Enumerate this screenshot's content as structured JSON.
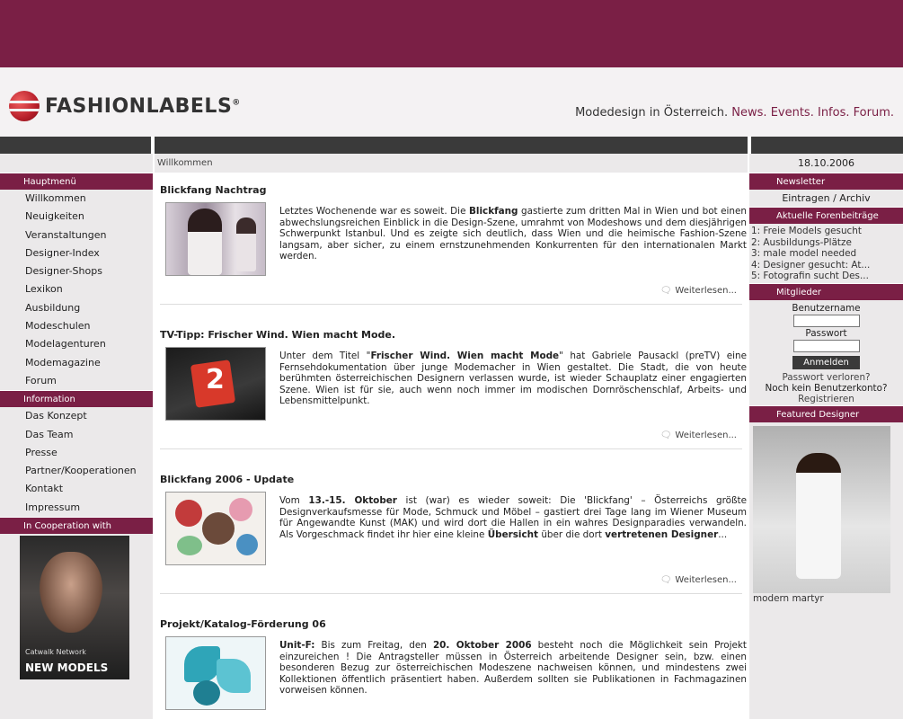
{
  "header": {
    "logo_text": "FASHIONLABELS",
    "logo_mark": "®",
    "tagline_prefix": "Modedesign in Österreich.",
    "tagline_links": [
      "News.",
      "Events.",
      "Infos.",
      "Forum."
    ]
  },
  "breadcrumb": "Willkommen",
  "date": "18.10.2006",
  "left_nav": {
    "main_head": "Hauptmenü",
    "main_items": [
      "Willkommen",
      "Neuigkeiten",
      "Veranstaltungen",
      "Designer-Index",
      "Designer-Shops",
      "Lexikon",
      "Ausbildung",
      "Modeschulen",
      "Modelagenturen",
      "Modemagazine",
      "Forum"
    ],
    "info_head": "Information",
    "info_items": [
      "Das Konzept",
      "Das Team",
      "Presse",
      "Partner/Kooperationen",
      "Kontakt",
      "Impressum"
    ],
    "coop_head": "In Cooperation with",
    "coop_small": "Catwalk Network",
    "coop_big": "NEW MODELS"
  },
  "articles": [
    {
      "title": "Blickfang Nachtrag",
      "text_html": "Letztes Wochenende war es soweit. Die <b>Blickfang</b> gastierte zum dritten Mal in Wien und bot einen abwechslungsreichen Einblick in die Design-Szene, umrahmt von Modeshows und dem diesjährigen Schwerpunkt Istanbul. Und es zeigte sich deutlich, dass Wien und die heimische Fashion-Szene langsam, aber sicher, zu einem ernstzunehmenden Konkurrenten für den internationalen Markt werden.",
      "more": "Weiterlesen..."
    },
    {
      "title": "TV-Tipp: Frischer Wind. Wien macht Mode.",
      "text_html": "Unter dem Titel \"<b>Frischer Wind. Wien macht Mode</b>\" hat Gabriele Pausackl (preTV) eine Fernsehdokumentation über junge Modemacher in Wien gestaltet. Die Stadt, die von heute berühmten österreichischen Designern verlassen wurde, ist wieder Schauplatz einer engagierten Szene. Wien ist für sie, auch wenn noch immer im modischen Dornröschenschlaf, Arbeits- und Lebensmittelpunkt.",
      "more": "Weiterlesen...",
      "thumb_label": "2"
    },
    {
      "title": "Blickfang 2006 - Update",
      "text_html": "Vom <b>13.-15. Oktober</b> ist (war) es wieder soweit: Die 'Blickfang' – Österreichs größte Designverkaufsmesse für Mode, Schmuck und Möbel – gastiert drei Tage lang im Wiener Museum für Angewandte Kunst (MAK) und wird dort die Hallen in ein wahres Designparadies verwandeln. Als Vorgeschmack findet ihr hier eine kleine <b>Übersicht</b> über die dort <b>vertretenen Designer</b>...",
      "more": "Weiterlesen..."
    },
    {
      "title": "Projekt/Katalog-Förderung 06",
      "text_html": "<b>Unit-F:</b> Bis zum Freitag, den <b>20. Oktober 2006</b> besteht noch die Möglichkeit sein Projekt einzureichen ! Die Antragsteller müssen in Österreich arbeitende Designer sein, bzw. einen besonderen Bezug zur österreichischen Modeszene nachweisen können, und mindestens zwei Kollektionen öffentlich präsentiert haben. Außerdem sollten sie Publikationen in Fachmagazinen vorweisen können."
    }
  ],
  "right": {
    "newsletter_head": "Newsletter",
    "newsletter_link": "Eintragen / Archiv",
    "forum_head": "Aktuelle Forenbeiträge",
    "forum_items": [
      "1: Freie Models gesucht",
      "2: Ausbildungs-Plätze",
      "3: male model needed",
      "4: Designer gesucht: At...",
      "5: Fotografin sucht Des..."
    ],
    "members_head": "Mitglieder",
    "username_label": "Benutzername",
    "password_label": "Passwort",
    "login_button": "Anmelden",
    "forgot": "Passwort verloren?",
    "no_account": "Noch kein Benutzerkonto?",
    "register": "Registrieren",
    "featured_head": "Featured Designer",
    "featured_caption": "modern martyr"
  },
  "colors": {
    "brand": "#7a1f45",
    "bar": "#3a3a3a",
    "panel": "#ebe9ea"
  }
}
